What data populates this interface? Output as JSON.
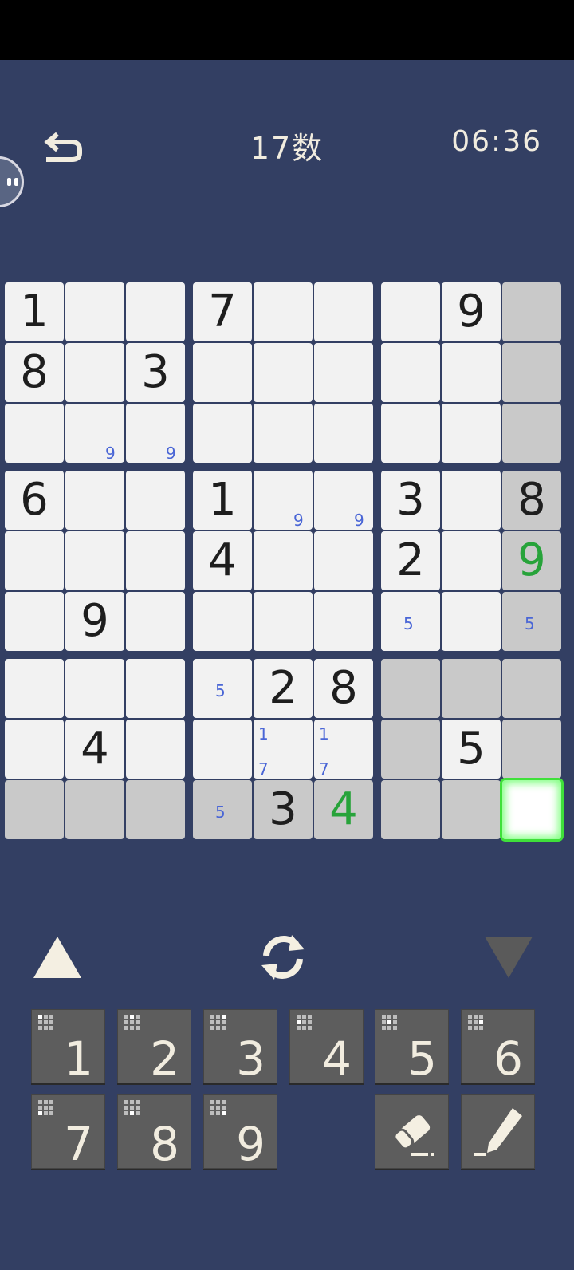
{
  "header": {
    "title": "17数",
    "timer": "06:36"
  },
  "board": {
    "rows": [
      [
        "1",
        "",
        "",
        "7",
        "",
        "",
        "",
        "9",
        ""
      ],
      [
        "8",
        "",
        "3",
        "",
        "",
        "",
        "",
        "",
        ""
      ],
      [
        "",
        "",
        "",
        "",
        "",
        "",
        "",
        "",
        ""
      ],
      [
        "6",
        "",
        "",
        "1",
        "",
        "",
        "3",
        "",
        "8"
      ],
      [
        "",
        "",
        "",
        "4",
        "",
        "",
        "2",
        "",
        "9"
      ],
      [
        "",
        "9",
        "",
        "",
        "",
        "",
        "",
        "",
        ""
      ],
      [
        "",
        "",
        "",
        "",
        "2",
        "8",
        "",
        "",
        ""
      ],
      [
        "",
        "4",
        "",
        "",
        "",
        "",
        "",
        "5",
        ""
      ],
      [
        "",
        "",
        "",
        "",
        "3",
        "4",
        "",
        "",
        ""
      ]
    ],
    "notes": [
      {
        "r": 2,
        "c": 1,
        "v": "9"
      },
      {
        "r": 2,
        "c": 2,
        "v": "9"
      },
      {
        "r": 3,
        "c": 4,
        "v": "9"
      },
      {
        "r": 3,
        "c": 5,
        "v": "9"
      },
      {
        "r": 5,
        "c": 6,
        "v": "5"
      },
      {
        "r": 5,
        "c": 8,
        "v": "5"
      },
      {
        "r": 6,
        "c": 3,
        "v": "5"
      },
      {
        "r": 7,
        "c": 4,
        "v": "1"
      },
      {
        "r": 7,
        "c": 4,
        "v": "7"
      },
      {
        "r": 7,
        "c": 5,
        "v": "1"
      },
      {
        "r": 7,
        "c": 5,
        "v": "7"
      },
      {
        "r": 8,
        "c": 3,
        "v": "5"
      }
    ],
    "grey_cells": [
      [
        0,
        8
      ],
      [
        1,
        8
      ],
      [
        2,
        8
      ],
      [
        3,
        8
      ],
      [
        4,
        8
      ],
      [
        5,
        8
      ],
      [
        6,
        6
      ],
      [
        6,
        7
      ],
      [
        6,
        8
      ],
      [
        7,
        6
      ],
      [
        7,
        8
      ],
      [
        8,
        0
      ],
      [
        8,
        1
      ],
      [
        8,
        2
      ],
      [
        8,
        3
      ],
      [
        8,
        4
      ],
      [
        8,
        5
      ],
      [
        8,
        6
      ],
      [
        8,
        7
      ]
    ],
    "green_cells": [
      [
        4,
        8
      ],
      [
        8,
        5
      ]
    ],
    "selected_cell": [
      8,
      8
    ],
    "colors": {
      "background": "#333f63",
      "cell": "#f2f2f2",
      "highlight": "#c9c9c9",
      "note": "#4a66d6",
      "entered": "#27a33a",
      "selected_glow": "#3fe03a"
    }
  },
  "controls": {
    "up_icon": "triangle-up-icon",
    "down_icon": "triangle-down-icon",
    "refresh_icon": "refresh-icon",
    "undo_icon": "undo-icon"
  },
  "keypad": {
    "keys": [
      "1",
      "2",
      "3",
      "4",
      "5",
      "6",
      "7",
      "8",
      "9"
    ],
    "eraser_icon": "eraser-icon",
    "pencil_icon": "pencil-icon"
  }
}
